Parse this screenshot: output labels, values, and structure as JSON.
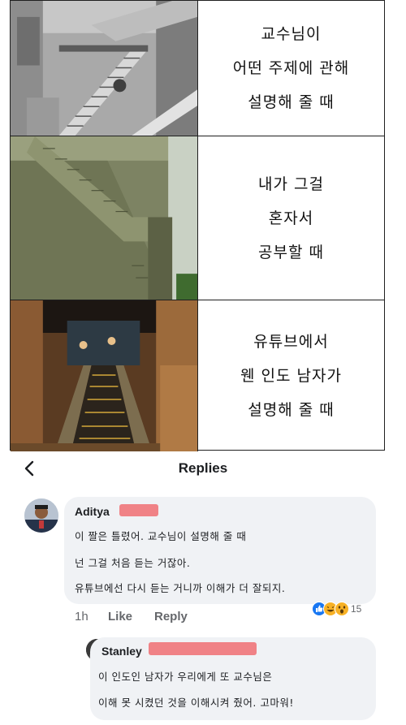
{
  "meme": {
    "rows": [
      {
        "lines": [
          "교수님이",
          "어떤 주제에 관해",
          "설명해 줄 때"
        ]
      },
      {
        "lines": [
          "내가 그걸",
          "혼자서",
          "공부할 때"
        ]
      },
      {
        "lines": [
          "유튜브에서",
          "웬 인도 남자가",
          "설명해 줄 때"
        ]
      }
    ]
  },
  "header": {
    "title": "Replies"
  },
  "comments": [
    {
      "author": "Aditya",
      "lines": [
        "이 짤은 틀렸어. 교수님이 설명해 줄 때",
        "넌 그걸 처음 듣는 거잖아.",
        "유튜브에선 다시 듣는 거니까 이해가 더 잘되지."
      ],
      "time": "1h",
      "like_label": "Like",
      "reply_label": "Reply",
      "reaction_count": "15",
      "reactions": [
        "like-reaction-icon",
        "haha-reaction-icon",
        "wow-reaction-icon"
      ]
    },
    {
      "author": "Stanley",
      "lines": [
        "이 인도인 남자가 우리에게 또 교수님은",
        "이해 못 시켰던 것을 이해시켜 줬어. 고마워!"
      ]
    }
  ],
  "colors": {
    "redaction": "#f0767a",
    "bubble": "#f0f2f5",
    "meta": "#65676b",
    "like_blue": "#1877f2",
    "reaction_yellow": "#f7b125"
  }
}
